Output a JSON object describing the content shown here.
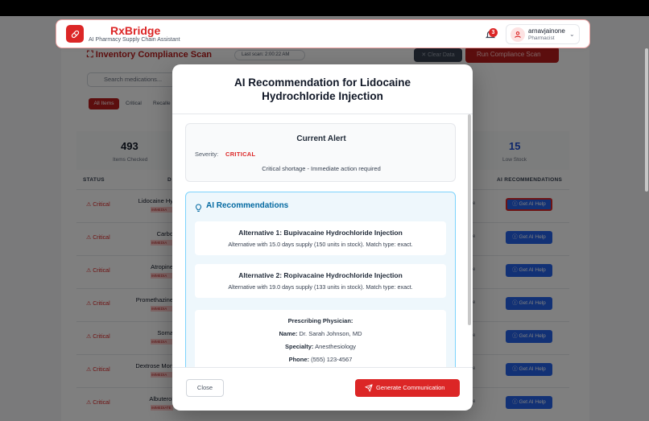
{
  "header": {
    "brand": "RxBridge",
    "subtitle": "AI Pharmacy Supply Chain Assistant",
    "notification_count": "3",
    "user_name": "arnavjainone",
    "user_role": "Pharmacist"
  },
  "background": {
    "title": "Inventory Compliance Scan",
    "last_scan": "Last scan: 2:00:22 AM",
    "clear_label": "Clear Data",
    "run_label": "Run Compliance Scan",
    "search_placeholder": "Search medications...",
    "filters": [
      "All Items",
      "Critical",
      "Recalle"
    ],
    "stats": [
      {
        "value": "493",
        "label": "Items Checked"
      },
      {
        "value": "15",
        "label": "Low Stock"
      }
    ],
    "columns": [
      "STATUS",
      "D",
      "AI RECOMMENDATIONS"
    ],
    "rows": [
      {
        "status": "Critical",
        "drug": "Lidocaine Hy",
        "badge": "IMMEDIA",
        "extra": "e",
        "action": "Get AI Help"
      },
      {
        "status": "Critical",
        "drug": "Carbo",
        "badge": "IMMEDIA",
        "extra": "e",
        "action": "Get AI Help"
      },
      {
        "status": "Critical",
        "drug": "Atropine",
        "badge": "IMMEDIA",
        "extra": "e",
        "action": "Get AI Help"
      },
      {
        "status": "Critical",
        "drug": "Promethazine",
        "badge": "IMMEDIA",
        "extra": "e",
        "action": "Get AI Help"
      },
      {
        "status": "Critical",
        "drug": "Soma",
        "badge": "IMMEDIA",
        "extra": "e",
        "action": "Get AI Help"
      },
      {
        "status": "Critical",
        "drug": "Dextrose Mon",
        "badge": "IMMEDIA",
        "extra": "e",
        "action": "Get AI Help"
      },
      {
        "status": "Critical",
        "drug": "Albuterol",
        "badge": "IMMEDIATE ACTION REQUIRED",
        "extra": "e",
        "action": "Get AI Help"
      }
    ]
  },
  "modal": {
    "title": "AI Recommendation for Lidocaine Hydrochloride Injection",
    "alert": {
      "heading": "Current Alert",
      "severity_label": "Severity:",
      "severity_value": "CRITICAL",
      "message": "Critical shortage - Immediate action required"
    },
    "recommendations": {
      "heading": "AI Recommendations",
      "alternatives": [
        {
          "title": "Alternative 1: Bupivacaine Hydrochloride Injection",
          "desc": "Alternative with 15.0 days supply (150 units in stock). Match type: exact."
        },
        {
          "title": "Alternative 2: Ropivacaine Hydrochloride Injection",
          "desc": "Alternative with 19.0 days supply (133 units in stock). Match type: exact."
        }
      ],
      "physician": {
        "heading": "Prescribing Physician:",
        "name_label": "Name:",
        "name": "Dr. Sarah Johnson, MD",
        "specialty_label": "Specialty:",
        "specialty": "Anesthesiology",
        "phone_label": "Phone:",
        "phone": "(555) 123-4567"
      }
    },
    "close_label": "Close",
    "generate_label": "Generate Communication"
  },
  "colors": {
    "brand_red": "#dc2626",
    "action_blue": "#2563eb",
    "rec_accent": "#0369a1"
  }
}
